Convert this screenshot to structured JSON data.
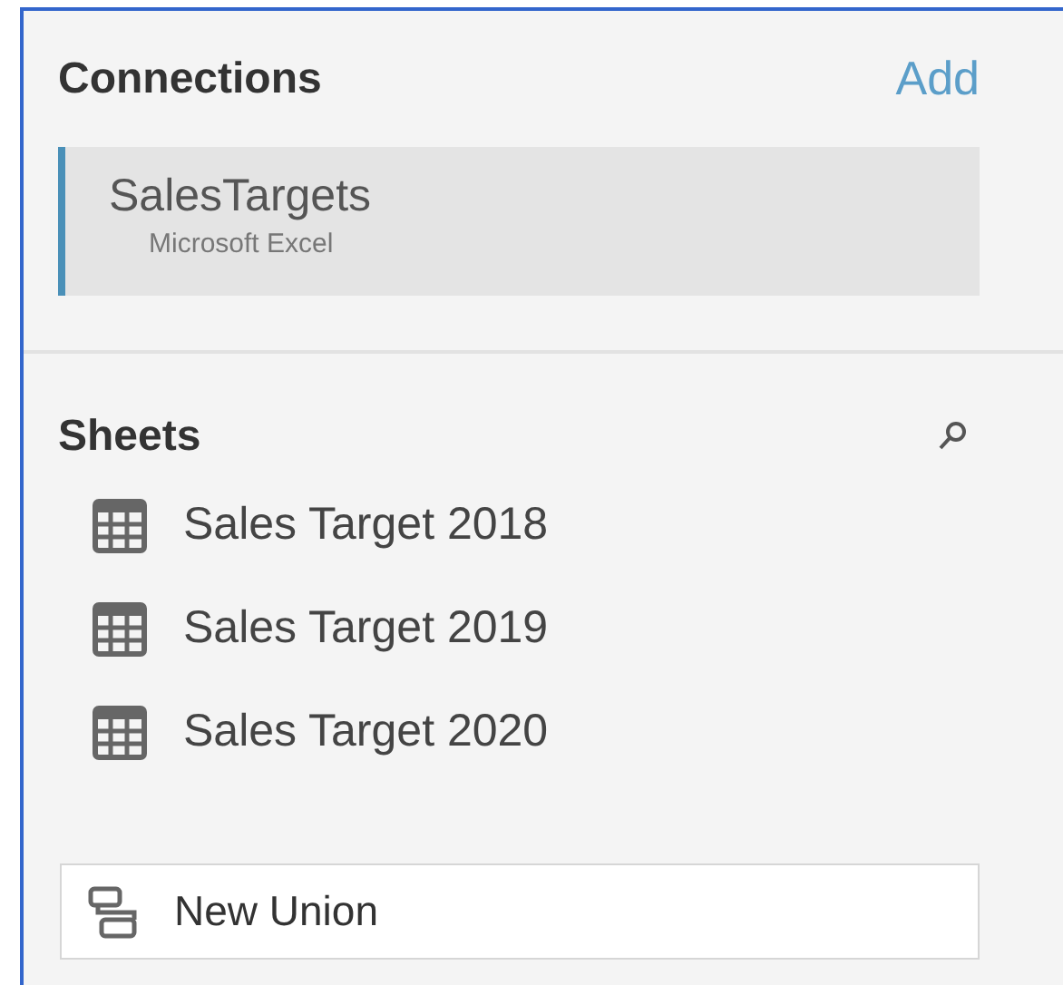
{
  "connections": {
    "title": "Connections",
    "add_label": "Add",
    "items": [
      {
        "name": "SalesTargets",
        "type": "Microsoft Excel",
        "selected": true
      }
    ]
  },
  "sheets": {
    "title": "Sheets",
    "items": [
      {
        "name": "Sales Target 2018"
      },
      {
        "name": "Sales Target 2019"
      },
      {
        "name": "Sales Target 2020"
      }
    ]
  },
  "new_union": {
    "label": "New Union"
  }
}
